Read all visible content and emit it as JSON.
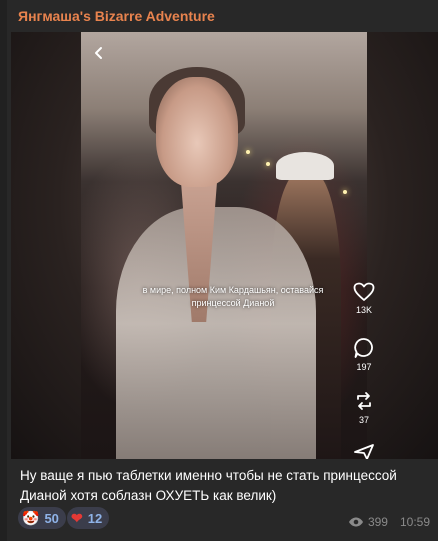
{
  "channel": {
    "name": "Янгмаша's Bizarre Adventure"
  },
  "video": {
    "overlay_text": "в мире, полном Ким Кардашьян, оставайся принцессой Дианой",
    "likes": "13K",
    "comments": "197",
    "reposts": "37"
  },
  "post": {
    "caption": "Ну ваще я пью таблетки именно чтобы не стать принцессой Дианой хотя соблазн ОХУЕТЬ как велик)"
  },
  "reactions": [
    {
      "emoji": "🤡",
      "emoji_name": "clown-face-icon",
      "count": "50"
    },
    {
      "emoji": "❤",
      "emoji_name": "heart-icon",
      "count": "12"
    }
  ],
  "meta": {
    "views": "399",
    "time": "10:59"
  },
  "colors": {
    "channel_name": "#e8834e",
    "reaction_bg": "#3b3d4b",
    "reaction_text": "#8fb3e8",
    "heart": "#e53935"
  }
}
